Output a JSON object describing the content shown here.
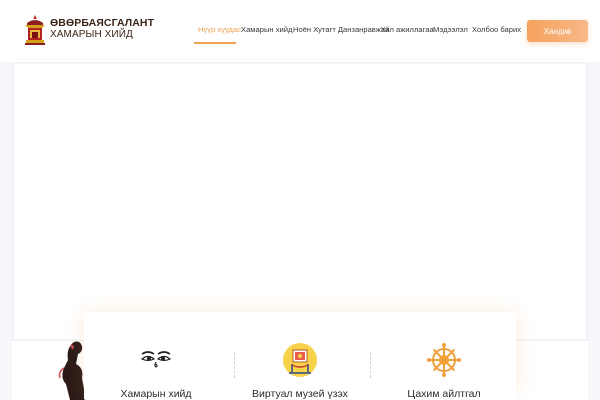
{
  "brand": {
    "line1": "ӨВӨРБАЯСГАЛАНТ",
    "line2": "ХАМАРЫН ХИЙД"
  },
  "nav": {
    "items": [
      {
        "label": "Нүүр хуудас",
        "active": true
      },
      {
        "label": "Хамарын хийд",
        "active": false
      },
      {
        "label": "Ноён Хутагт Данзанравжаа",
        "active": false
      },
      {
        "label": "Үйл ажиллагаа",
        "active": false
      },
      {
        "label": "Мэдээлэл",
        "active": false
      },
      {
        "label": "Холбоо барих",
        "active": false
      }
    ],
    "donate_label": "Хандив"
  },
  "features": [
    {
      "label": "Хамарын хийд",
      "icon": "buddha-eyes-icon"
    },
    {
      "label": "Виртуал музей үзэх",
      "icon": "museum-exhibit-icon"
    },
    {
      "label": "Цахим айлтгал",
      "icon": "dharma-wheel-icon"
    }
  ],
  "colors": {
    "accent": "#f0a254",
    "button_gradient_start": "#f6a35e",
    "button_gradient_end": "#f7b887",
    "brand_text": "#3a2418"
  }
}
